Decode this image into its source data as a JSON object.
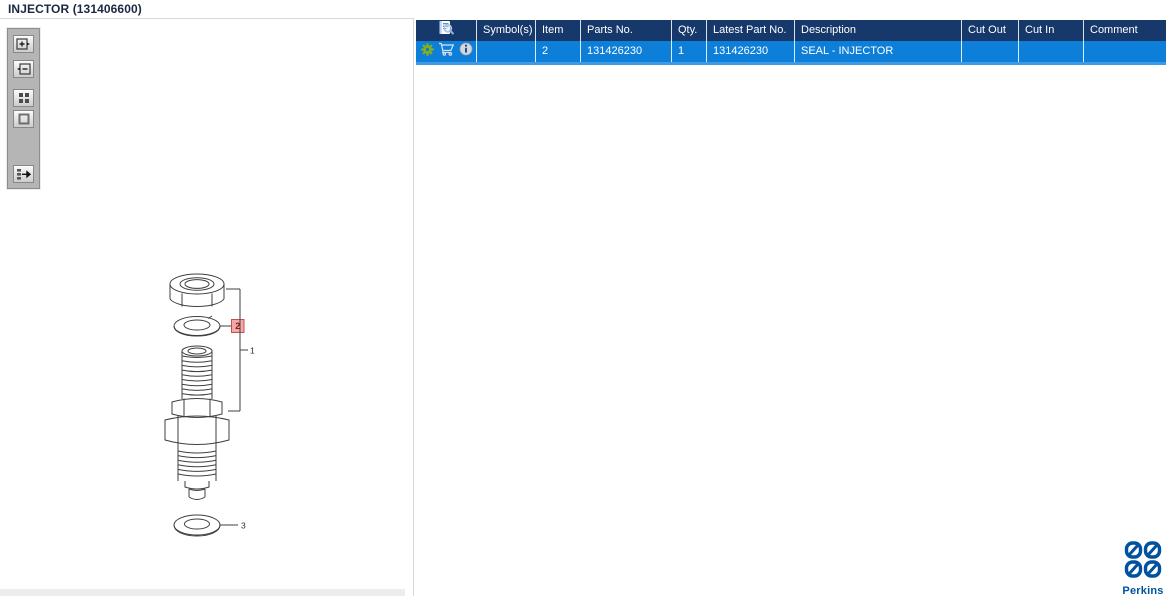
{
  "title": "INJECTOR (131406600)",
  "toolbar": {
    "items": [
      {
        "name": "zoom-in-icon"
      },
      {
        "name": "zoom-out-icon"
      },
      {
        "name": "tile-view-icon"
      },
      {
        "name": "single-view-icon"
      },
      {
        "name": "toggle-list-panel-icon"
      }
    ]
  },
  "diagram": {
    "callouts": [
      "1",
      "2",
      "3"
    ],
    "highlighted_item": "2",
    "highlight_color": "#f4a9a9",
    "highlight_border": "#c94f4f"
  },
  "table": {
    "columns": [
      "",
      "Symbol(s)",
      "Item",
      "Parts No.",
      "Qty.",
      "Latest Part No.",
      "Description",
      "Cut Out",
      "Cut In",
      "Comment"
    ],
    "header_icon": "document-search-icon",
    "rows": [
      {
        "icons": [
          "gear-icon",
          "cart-icon",
          "info-icon"
        ],
        "symbols": "",
        "item": "2",
        "parts_no": "131426230",
        "qty": "1",
        "latest_part_no": "131426230",
        "description": "SEAL - INJECTOR",
        "cut_out": "",
        "cut_in": "",
        "comment": ""
      }
    ]
  },
  "branding": {
    "logo_text": "Perkins"
  },
  "colors": {
    "header_bg": "#16386b",
    "selected_row_bg": "#0e7fd9",
    "selected_row_strip": "#3d9be5",
    "brand_blue": "#00519e"
  }
}
